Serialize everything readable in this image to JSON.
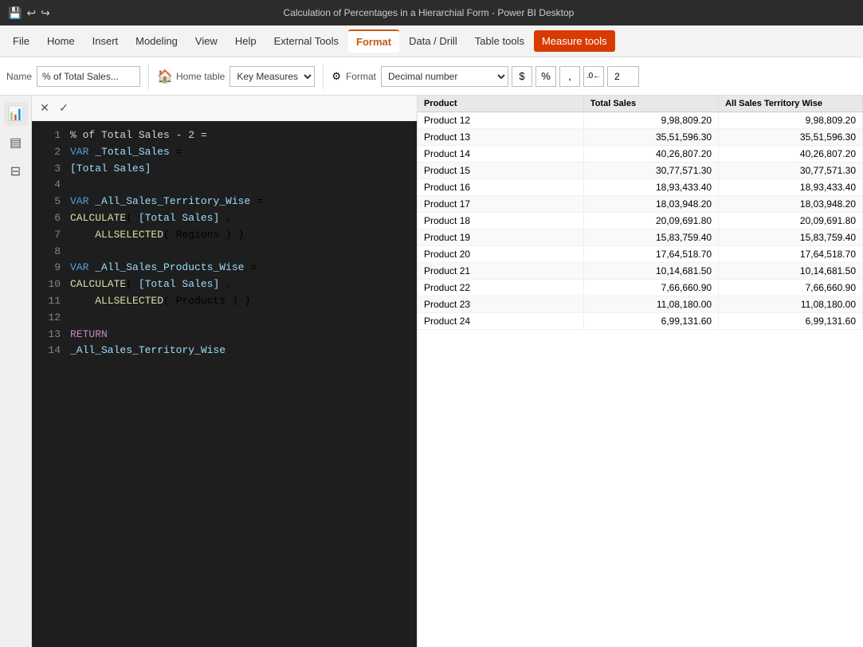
{
  "titleBar": {
    "title": "Calculation of Percentages in a Hierarchial Form - Power BI Desktop",
    "icons": [
      "save-icon",
      "undo-icon",
      "redo-icon"
    ]
  },
  "menuBar": {
    "items": [
      {
        "id": "file",
        "label": "File"
      },
      {
        "id": "home",
        "label": "Home"
      },
      {
        "id": "insert",
        "label": "Insert"
      },
      {
        "id": "modeling",
        "label": "Modeling"
      },
      {
        "id": "view",
        "label": "View"
      },
      {
        "id": "help",
        "label": "Help"
      },
      {
        "id": "external-tools",
        "label": "External Tools"
      },
      {
        "id": "format",
        "label": "Format",
        "active": true
      },
      {
        "id": "data-drill",
        "label": "Data / Drill"
      },
      {
        "id": "table-tools",
        "label": "Table tools"
      },
      {
        "id": "measure-tools",
        "label": "Measure tools",
        "activeTab": true
      }
    ]
  },
  "ribbon": {
    "nameLabel": "Name",
    "nameValue": "% of Total Sales...",
    "homeLabel": "Home table",
    "homeValue": "Key Measures",
    "formatLabel": "Format",
    "formatValue": "Decimal number",
    "dollarLabel": "$",
    "percentLabel": "%",
    "commaLabel": ",",
    "decimalLabel": ".00",
    "decimalValue": "2"
  },
  "formulaControls": {
    "closeLabel": "✕",
    "checkLabel": "✓"
  },
  "codeLines": [
    {
      "num": 1,
      "raw": "% of Total Sales - 2 =",
      "type": "comment-header"
    },
    {
      "num": 2,
      "raw": "VAR _Total_Sales =",
      "type": "var-decl"
    },
    {
      "num": 3,
      "raw": "[Total Sales]",
      "type": "ref"
    },
    {
      "num": 4,
      "raw": "",
      "type": "empty"
    },
    {
      "num": 5,
      "raw": "VAR _All_Sales_Territory_Wise =",
      "type": "var-decl"
    },
    {
      "num": 6,
      "raw": "CALCULATE( [Total Sales] ,",
      "type": "func"
    },
    {
      "num": 7,
      "raw": "    ALLSELECTED( Regions ) )",
      "type": "func-inner"
    },
    {
      "num": 8,
      "raw": "",
      "type": "empty"
    },
    {
      "num": 9,
      "raw": "VAR _All_Sales_Products_Wise =",
      "type": "var-decl"
    },
    {
      "num": 10,
      "raw": "CALCULATE( [Total Sales] ,",
      "type": "func"
    },
    {
      "num": 11,
      "raw": "    ALLSELECTED( Products ) )",
      "type": "func-inner"
    },
    {
      "num": 12,
      "raw": "",
      "type": "empty"
    },
    {
      "num": 13,
      "raw": "RETURN",
      "type": "return"
    },
    {
      "num": 14,
      "raw": "_All_Sales_Territory_Wise",
      "type": "ref-var"
    }
  ],
  "tableColumns": [
    "Product",
    "Total Sales",
    "All Sales Territory Wise"
  ],
  "tableRows": [
    {
      "product": "Product 12",
      "col1": "9,98,809.20",
      "col2": "9,98,809.20"
    },
    {
      "product": "Product 13",
      "col1": "35,51,596.30",
      "col2": "35,51,596.30"
    },
    {
      "product": "Product 14",
      "col1": "40,26,807.20",
      "col2": "40,26,807.20"
    },
    {
      "product": "Product 15",
      "col1": "30,77,571.30",
      "col2": "30,77,571.30"
    },
    {
      "product": "Product 16",
      "col1": "18,93,433.40",
      "col2": "18,93,433.40"
    },
    {
      "product": "Product 17",
      "col1": "18,03,948.20",
      "col2": "18,03,948.20"
    },
    {
      "product": "Product 18",
      "col1": "20,09,691.80",
      "col2": "20,09,691.80"
    },
    {
      "product": "Product 19",
      "col1": "15,83,759.40",
      "col2": "15,83,759.40"
    },
    {
      "product": "Product 20",
      "col1": "17,64,518.70",
      "col2": "17,64,518.70"
    },
    {
      "product": "Product 21",
      "col1": "10,14,681.50",
      "col2": "10,14,681.50"
    },
    {
      "product": "Product 22",
      "col1": "7,66,660.90",
      "col2": "7,66,660.90"
    },
    {
      "product": "Product 23",
      "col1": "11,08,180.00",
      "col2": "11,08,180.00"
    },
    {
      "product": "Product 24",
      "col1": "6,99,131.60",
      "col2": "6,99,131.60"
    }
  ]
}
